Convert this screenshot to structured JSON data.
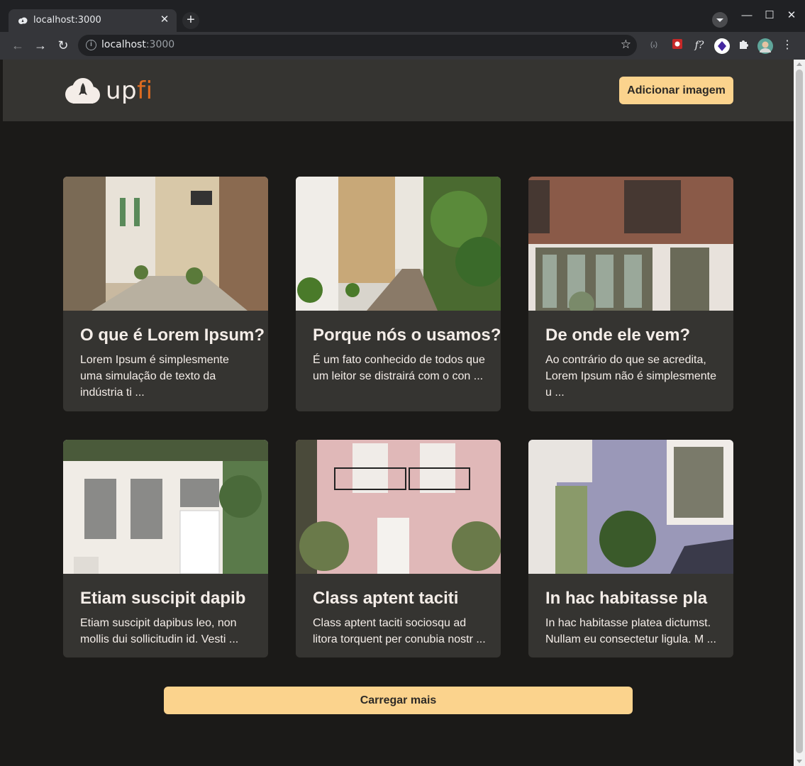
{
  "browser": {
    "tab_title": "localhost:3000",
    "url_host": "localhost",
    "url_port": ":3000",
    "new_tab_label": "+",
    "close_tab_label": "✕",
    "minimize_label": "—",
    "maximize_label": "☐",
    "close_window_label": "✕",
    "back_label": "←",
    "forward_label": "→",
    "reload_label": "↻",
    "star_label": "☆",
    "ext_labels": [
      "(ₓ)",
      "f?"
    ]
  },
  "header": {
    "logo_main": "up",
    "logo_accent": "fi",
    "add_button": "Adicionar imagem"
  },
  "cards": [
    {
      "title": "O que é Lorem Ipsum?",
      "description": "Lorem Ipsum é simplesmente uma simulação de texto da indústria ti ...",
      "image": "street-alley-photo"
    },
    {
      "title": "Porque nós o usamos?",
      "description": "É um fato conhecido de todos que um leitor se distrairá com o con ...",
      "image": "mews-street-photo"
    },
    {
      "title": "De onde ele vem?",
      "description": "Ao contrário do que se acredita, Lorem Ipsum não é simplesmente u ...",
      "image": "brick-house-photo"
    },
    {
      "title": "Etiam suscipit dapib",
      "description": "Etiam suscipit dapibus leo, non mollis dui sollicitudin id. Vesti ...",
      "image": "white-house-photo"
    },
    {
      "title": "Class aptent taciti",
      "description": "Class aptent taciti sociosqu ad litora torquent per conubia nostr ...",
      "image": "pink-house-photo"
    },
    {
      "title": "In hac habitasse pla",
      "description": "In hac habitasse platea dictumst. Nullam eu consectetur ligula. M ...",
      "image": "green-door-photo"
    }
  ],
  "load_more": "Carregar mais",
  "colors": {
    "background": "#1b1a18",
    "surface": "#353431",
    "accent_button": "#fbd38d",
    "text": "#f4ede8",
    "logo_accent": "#dd6b20"
  }
}
